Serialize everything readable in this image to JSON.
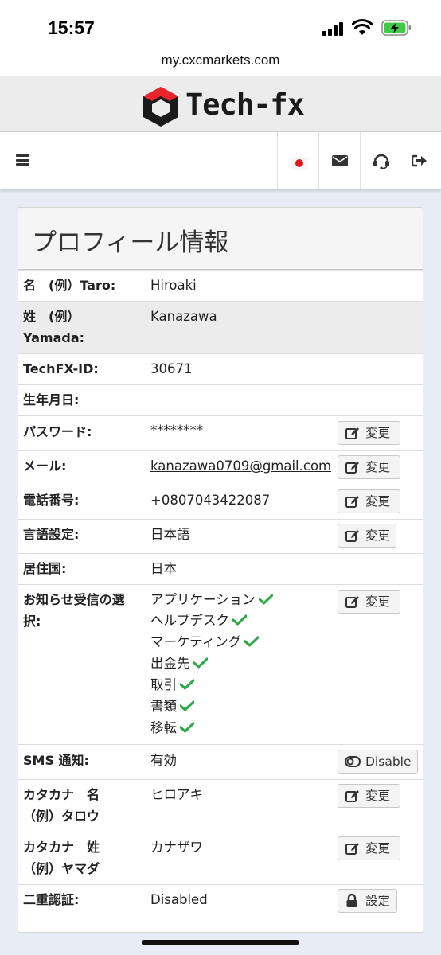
{
  "status_bar": {
    "time": "15:57"
  },
  "browser": {
    "url": "my.cxcmarkets.com"
  },
  "brand": {
    "name": "Tech-fx",
    "accent": "#e8262b"
  },
  "card": {
    "title": "プロフィール情報"
  },
  "fields": {
    "first_name": {
      "label_1": "名　(例）Taro:",
      "value": "Hiroaki"
    },
    "last_name": {
      "label_1": "姓　(例）",
      "label_2": "Yamada:",
      "value": "Kanazawa"
    },
    "techfx_id": {
      "label_1": "TechFX-ID:",
      "value": "30671"
    },
    "birthdate": {
      "label_1": "生年月日:",
      "value": ""
    },
    "password": {
      "label_1": "パスワード:",
      "value": "********",
      "button": "変更"
    },
    "email": {
      "label_1": "メール:",
      "value": "kanazawa0709@gmail.com",
      "button": "変更"
    },
    "phone": {
      "label_1": "電話番号:",
      "value": "+0807043422087",
      "button": "変更"
    },
    "language": {
      "label_1": "言語設定:",
      "value": "日本語",
      "button": "変更"
    },
    "country": {
      "label_1": "居住国:",
      "value": "日本"
    },
    "notifications": {
      "label_1": "お知らせ受信の選",
      "label_2": "択:",
      "button": "変更",
      "options": [
        "アプリケーション",
        "ヘルプデスク",
        "マーケティング",
        "出金先",
        "取引",
        "書類",
        "移転"
      ]
    },
    "sms": {
      "label_1": "SMS 通知:",
      "value": "有効",
      "button": "Disable"
    },
    "katakana_first": {
      "label_1": "カタカナ　名",
      "label_2": "（例）タロウ",
      "value": "ヒロアキ",
      "button": "変更"
    },
    "katakana_last": {
      "label_1": "カタカナ　姓",
      "label_2": "（例）ヤマダ",
      "value": "カナザワ",
      "button": "変更"
    },
    "two_factor": {
      "label_1": "二重認証:",
      "value": "Disabled",
      "button": "設定"
    }
  },
  "colors": {
    "check": "#2eaa4a"
  }
}
